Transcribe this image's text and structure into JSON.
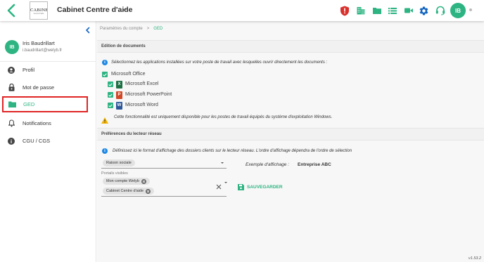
{
  "header": {
    "org_name": "Cabinet Centre d'aide",
    "logo_text": "CABINET",
    "logo_subtext": "Centre d'aide",
    "user_initials": "IB",
    "icons": [
      "shield-alert-icon",
      "business-icon",
      "folder-icon",
      "list-icon",
      "video-icon",
      "settings-gear-icon",
      "headset-support-icon"
    ]
  },
  "user": {
    "name": "Iris Baudrillart",
    "email": "i.baudrillart@welyb.fr",
    "initials": "IB"
  },
  "sidebar": {
    "items": [
      {
        "label": "Profil",
        "icon": "person-icon"
      },
      {
        "label": "Mot de passe",
        "icon": "lock-icon"
      },
      {
        "label": "GED",
        "icon": "folder-icon"
      },
      {
        "label": "Notifications",
        "icon": "bell-icon"
      },
      {
        "label": "CGU / CGS",
        "icon": "info-icon"
      }
    ],
    "active": "GED"
  },
  "breadcrumb": {
    "parent": "Paramètres du compte",
    "separator": ">",
    "current": "GED"
  },
  "documents_section": {
    "title": "Edition de documents",
    "instruction": "Sélectionnez les applications installées sur votre poste de travail avec lesquelles ouvrir directement les documents :",
    "parent_option": "Microsoft Office",
    "apps": [
      {
        "label": "Microsoft Excel",
        "letter": "X",
        "color": "#1d7044"
      },
      {
        "label": "Microsoft PowerPoint",
        "letter": "P",
        "color": "#d24726"
      },
      {
        "label": "Microsoft Word",
        "letter": "W",
        "color": "#2b579a"
      }
    ],
    "warning": "Cette fonctionnalité est uniquement disponible pour les postes de travail équipés du système d'exploitation Windows."
  },
  "network_section": {
    "title": "Préférences du lecteur réseau",
    "instruction": "Définissez ici le format d'affichage des dossiers clients sur le lecteur réseau. L'ordre d'affichage dépendra de l'ordre de sélection",
    "format_chip": "Raison sociale",
    "portals_label": "Portails visibles",
    "portals": [
      "Mon compte Welyb",
      "Cabinet Centre d'aide"
    ],
    "example_label": "Exemple d'affichage :",
    "example_value": "Entreprise ABC",
    "save_label": "SAUVEGARDER"
  },
  "version": "v1.53.2",
  "colors": {
    "accent": "#2db482",
    "highlight": "#e02424",
    "info": "#1e88e5",
    "warning": "#f5b400",
    "shield": "#d9302c"
  }
}
